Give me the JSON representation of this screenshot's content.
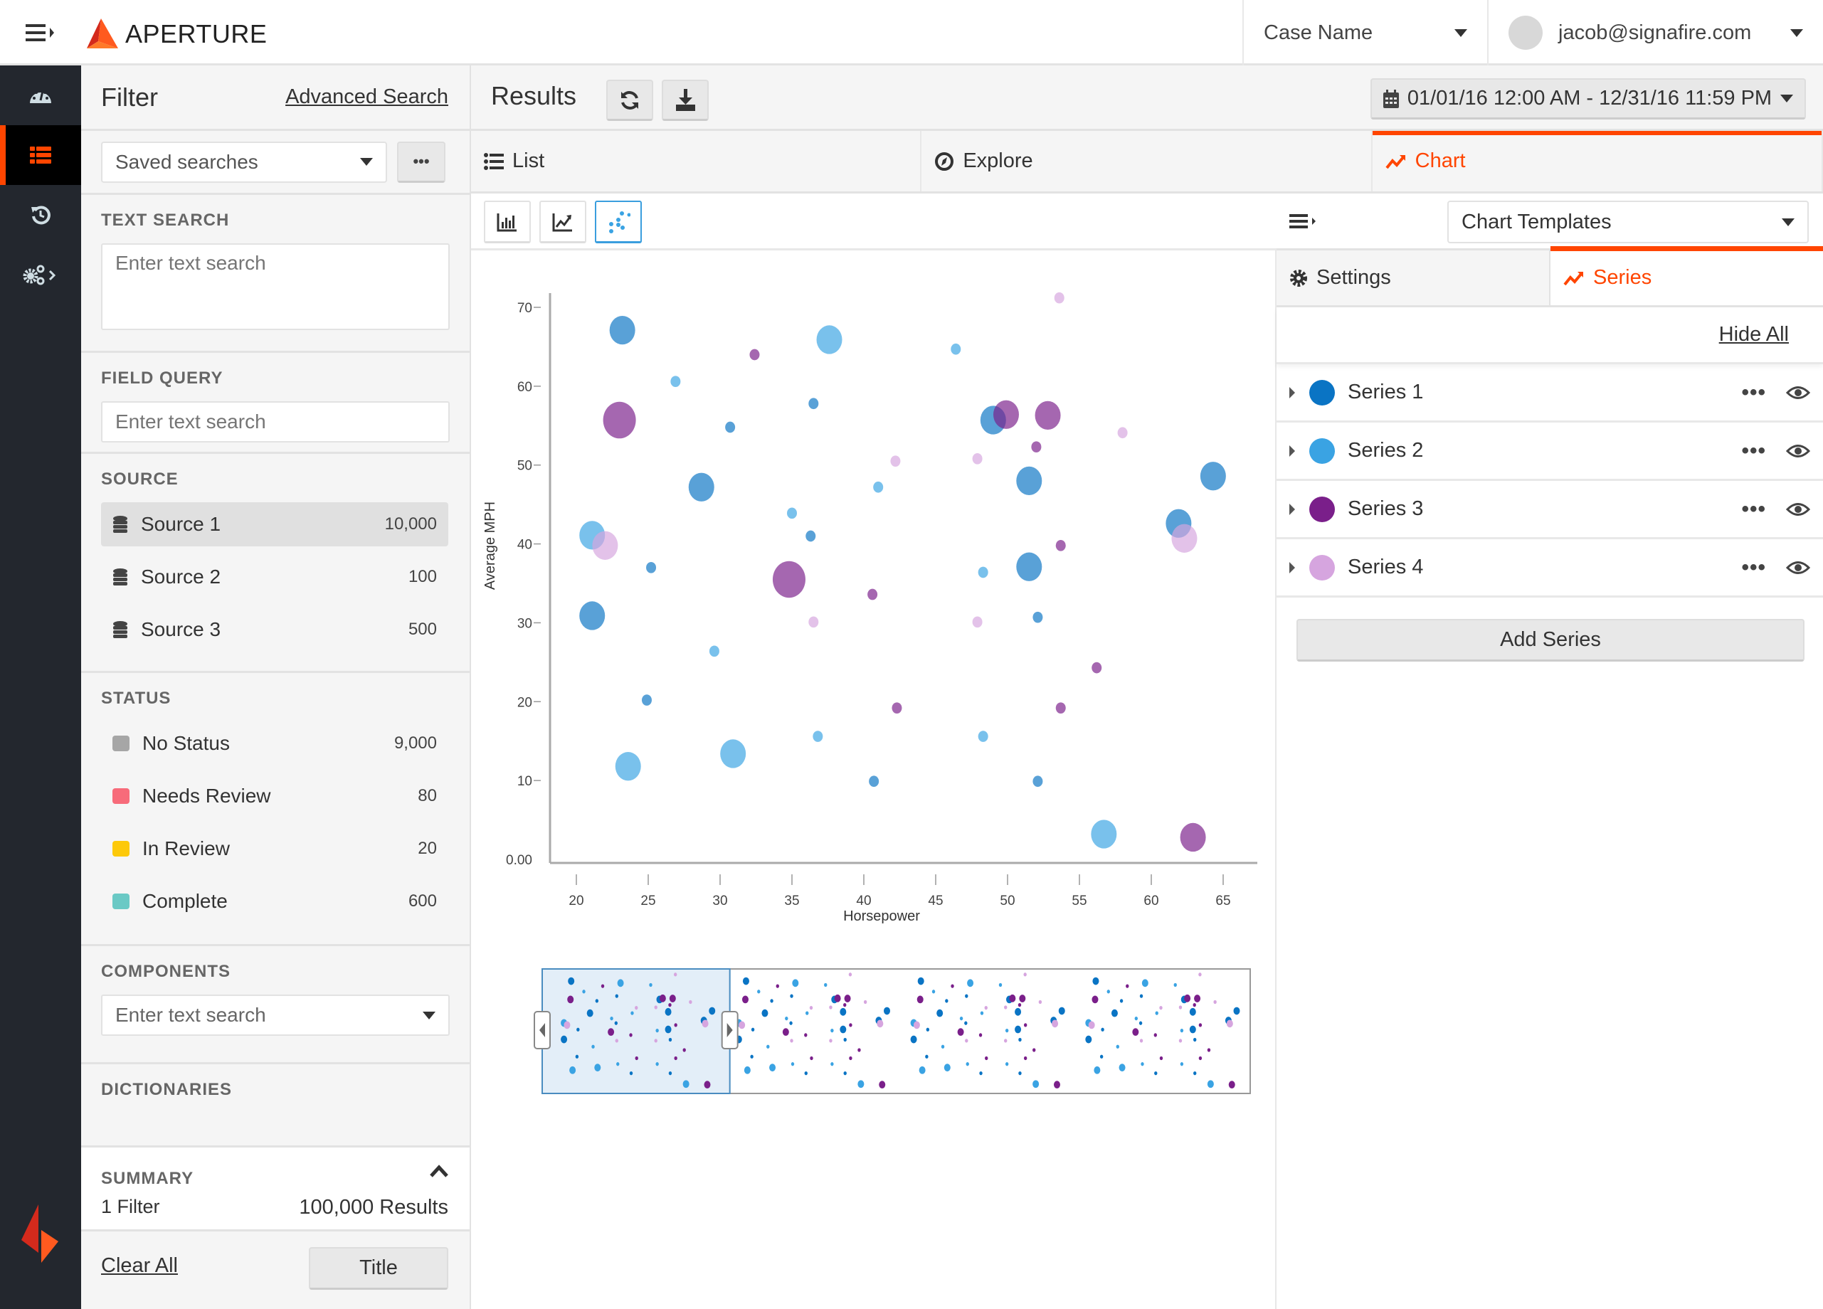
{
  "app": {
    "name": "APERTURE",
    "case_name": "Case Name",
    "user_email": "jacob@signafire.com"
  },
  "leftnav": {
    "items": [
      {
        "icon": "dashboard-icon",
        "active": false
      },
      {
        "icon": "list-icon",
        "active": true
      },
      {
        "icon": "history-icon",
        "active": false
      },
      {
        "icon": "settings-icon",
        "active": false
      }
    ]
  },
  "filter": {
    "title": "Filter",
    "advanced_search": "Advanced Search",
    "saved_searches": "Saved searches",
    "more_label": "•••",
    "text_search": {
      "label": "TEXT SEARCH",
      "placeholder": "Enter text search"
    },
    "field_query": {
      "label": "FIELD QUERY",
      "placeholder": "Enter text search"
    },
    "source": {
      "label": "SOURCE",
      "items": [
        {
          "name": "Source 1",
          "count": "10,000",
          "selected": true
        },
        {
          "name": "Source 2",
          "count": "100",
          "selected": false
        },
        {
          "name": "Source 3",
          "count": "500",
          "selected": false
        }
      ]
    },
    "status": {
      "label": "STATUS",
      "items": [
        {
          "name": "No Status",
          "count": "9,000",
          "color": "#a6a6a6"
        },
        {
          "name": "Needs Review",
          "count": "80",
          "color": "#f76b7a"
        },
        {
          "name": "In Review",
          "count": "20",
          "color": "#fdc90a"
        },
        {
          "name": "Complete",
          "count": "600",
          "color": "#6ac9c5"
        }
      ]
    },
    "components": {
      "label": "COMPONENTS",
      "placeholder": "Enter text search"
    },
    "dictionaries": {
      "label": "DICTIONARIES"
    },
    "summary": {
      "label": "SUMMARY",
      "filters": "1 Filter",
      "results": "100,000 Results"
    },
    "clear_all": "Clear All",
    "title_button": "Title"
  },
  "results": {
    "title": "Results",
    "date_range": "01/01/16 12:00 AM - 12/31/16 11:59 PM",
    "tabs": [
      {
        "label": "List",
        "icon": "list-icon",
        "active": false
      },
      {
        "label": "Explore",
        "icon": "compass-icon",
        "active": false
      },
      {
        "label": "Chart",
        "icon": "chart-line-icon",
        "active": true
      }
    ],
    "chart_types": [
      "bar-chart",
      "line-chart",
      "scatter-chart"
    ],
    "active_chart_type": "scatter-chart"
  },
  "right_panel": {
    "chart_templates": "Chart Templates",
    "tabs": [
      {
        "label": "Settings",
        "active": false
      },
      {
        "label": "Series",
        "active": true
      }
    ],
    "hide_all": "Hide All",
    "series": [
      {
        "name": "Series 1",
        "color": "#0a74c4"
      },
      {
        "name": "Series 2",
        "color": "#3aa3e3"
      },
      {
        "name": "Series 3",
        "color": "#7a1f8a"
      },
      {
        "name": "Series 4",
        "color": "#d6a5df"
      }
    ],
    "add_series": "Add Series"
  },
  "chart_data": {
    "type": "scatter",
    "title": "",
    "xlabel": "Horsepower",
    "ylabel": "Average MPH",
    "xlim": [
      16,
      67
    ],
    "ylim": [
      0,
      72
    ],
    "x_ticks": [
      20,
      25,
      30,
      35,
      40,
      45,
      50,
      55,
      60,
      65
    ],
    "y_ticks": [
      "0.00",
      "10",
      "20",
      "30",
      "40",
      "50",
      "60",
      "70"
    ],
    "y_tick_values": [
      0,
      10,
      20,
      30,
      40,
      50,
      60,
      70
    ],
    "grid": false,
    "legend": "right-panel",
    "series": [
      {
        "name": "Series 1",
        "color": "#0a74c4",
        "points": [
          {
            "x": 23.2,
            "y": 67.1,
            "size": "large"
          },
          {
            "x": 28.7,
            "y": 47.2,
            "size": "large"
          },
          {
            "x": 21.1,
            "y": 30.9,
            "size": "large"
          },
          {
            "x": 30.7,
            "y": 54.8,
            "size": "small"
          },
          {
            "x": 36.5,
            "y": 57.8,
            "size": "small"
          },
          {
            "x": 36.3,
            "y": 41.0,
            "size": "small"
          },
          {
            "x": 25.2,
            "y": 37.0,
            "size": "small"
          },
          {
            "x": 24.9,
            "y": 20.2,
            "size": "small"
          },
          {
            "x": 40.7,
            "y": 9.9,
            "size": "small"
          },
          {
            "x": 49.0,
            "y": 55.7,
            "size": "large"
          },
          {
            "x": 51.5,
            "y": 48.0,
            "size": "large"
          },
          {
            "x": 51.5,
            "y": 37.1,
            "size": "large"
          },
          {
            "x": 52.1,
            "y": 30.7,
            "size": "small"
          },
          {
            "x": 52.1,
            "y": 9.9,
            "size": "small"
          },
          {
            "x": 64.3,
            "y": 48.6,
            "size": "large"
          },
          {
            "x": 61.9,
            "y": 42.6,
            "size": "large"
          }
        ]
      },
      {
        "name": "Series 2",
        "color": "#3aa3e3",
        "points": [
          {
            "x": 37.6,
            "y": 65.9,
            "size": "large"
          },
          {
            "x": 21.1,
            "y": 41.1,
            "size": "large"
          },
          {
            "x": 23.6,
            "y": 11.8,
            "size": "large"
          },
          {
            "x": 30.9,
            "y": 13.4,
            "size": "large"
          },
          {
            "x": 56.7,
            "y": 3.2,
            "size": "large"
          },
          {
            "x": 26.9,
            "y": 60.6,
            "size": "small"
          },
          {
            "x": 35.0,
            "y": 43.9,
            "size": "small"
          },
          {
            "x": 29.6,
            "y": 26.4,
            "size": "small"
          },
          {
            "x": 36.8,
            "y": 15.6,
            "size": "small"
          },
          {
            "x": 46.4,
            "y": 64.7,
            "size": "small"
          },
          {
            "x": 41.0,
            "y": 47.2,
            "size": "small"
          },
          {
            "x": 48.3,
            "y": 36.4,
            "size": "small"
          },
          {
            "x": 48.3,
            "y": 15.6,
            "size": "small"
          }
        ]
      },
      {
        "name": "Series 3",
        "color": "#7a1f8a",
        "points": [
          {
            "x": 23.0,
            "y": 55.7,
            "size": "xlarge"
          },
          {
            "x": 34.8,
            "y": 35.5,
            "size": "xlarge"
          },
          {
            "x": 49.9,
            "y": 56.4,
            "size": "large"
          },
          {
            "x": 52.8,
            "y": 56.3,
            "size": "large"
          },
          {
            "x": 62.9,
            "y": 2.8,
            "size": "large"
          },
          {
            "x": 32.4,
            "y": 64.0,
            "size": "small"
          },
          {
            "x": 40.6,
            "y": 33.6,
            "size": "small"
          },
          {
            "x": 42.3,
            "y": 19.2,
            "size": "small"
          },
          {
            "x": 52.0,
            "y": 52.3,
            "size": "small"
          },
          {
            "x": 53.7,
            "y": 39.8,
            "size": "small"
          },
          {
            "x": 53.7,
            "y": 19.2,
            "size": "small"
          },
          {
            "x": 56.2,
            "y": 24.3,
            "size": "small"
          }
        ]
      },
      {
        "name": "Series 4",
        "color": "#d6a5df",
        "points": [
          {
            "x": 22.0,
            "y": 39.8,
            "size": "large"
          },
          {
            "x": 62.3,
            "y": 40.7,
            "size": "large"
          },
          {
            "x": 53.6,
            "y": 71.2,
            "size": "small"
          },
          {
            "x": 42.2,
            "y": 50.5,
            "size": "small"
          },
          {
            "x": 36.5,
            "y": 30.1,
            "size": "small"
          },
          {
            "x": 47.9,
            "y": 50.8,
            "size": "small"
          },
          {
            "x": 47.9,
            "y": 30.1,
            "size": "small"
          },
          {
            "x": 58.0,
            "y": 54.1,
            "size": "small"
          }
        ]
      }
    ],
    "navigator": {
      "selected_fraction": [
        0.0,
        0.265
      ]
    }
  }
}
